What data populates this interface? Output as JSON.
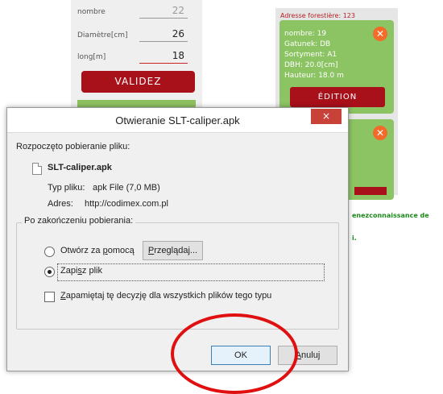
{
  "bg_form": {
    "rows": [
      {
        "label": "nombre",
        "value": "22"
      },
      {
        "label": "Diamètre[cm]",
        "value": "26"
      },
      {
        "label": "long[m]",
        "value": "18"
      }
    ],
    "validate_label": "VALIDEZ"
  },
  "bg_list": {
    "header": "Adresse forestière: 123",
    "card": {
      "lines": [
        "nombre: 19",
        "Gatunek: DB",
        "Sortyment: A1",
        "DBH: 20.0[cm]",
        "Hauteur: 18.0 m"
      ],
      "edit_label": "ÉDITION"
    },
    "note_fragment_1": "enezconnaissance de",
    "note_fragment_2": "i."
  },
  "dialog": {
    "title": "Otwieranie SLT-caliper.apk",
    "close_symbol": "×",
    "intro": "Rozpoczęto pobieranie pliku:",
    "file_name": "SLT-caliper.apk",
    "type_label": "Typ pliku:",
    "type_value": "apk File (7,0 MB)",
    "address_label": "Adres:",
    "address_value": "http://codimex.com.pl",
    "group_title": "Po zakończeniu pobierania:",
    "open_with_prefix": "Otwórz za ",
    "open_with_accel": "p",
    "open_with_suffix": "omocą",
    "browse_accel": "P",
    "browse_rest": "rzeglądaj...",
    "save_prefix": "Zapi",
    "save_accel": "s",
    "save_suffix": "z plik",
    "remember_accel": "Z",
    "remember_rest": "apamiętaj tę decyzję dla wszystkich plików tego typu",
    "ok_label": "OK",
    "cancel_accel": "A",
    "cancel_rest": "nuluj"
  },
  "colors": {
    "accent_red": "#a8101a",
    "card_green": "#8cc463",
    "highlight_circle": "#e01010"
  }
}
